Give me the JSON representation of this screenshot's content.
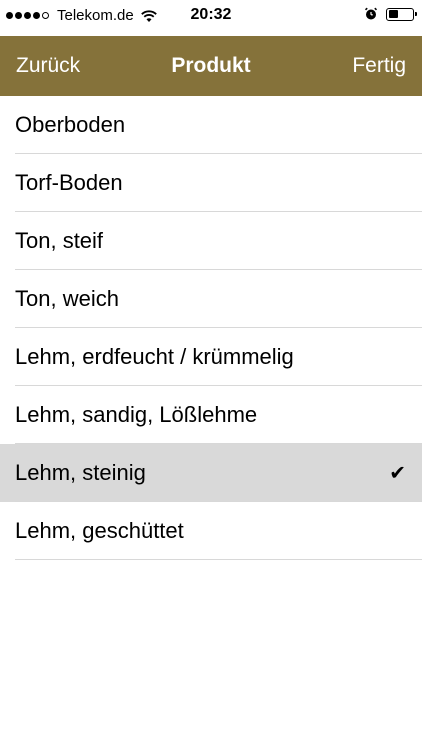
{
  "status_bar": {
    "carrier": "Telekom.de",
    "time": "20:32",
    "signal_bars_filled": 4,
    "signal_bars_total": 5,
    "icons": [
      "wifi-icon",
      "alarm-icon",
      "battery-icon"
    ]
  },
  "nav": {
    "back_label": "Zurück",
    "title": "Produkt",
    "done_label": "Fertig",
    "color": "#85723a"
  },
  "list": {
    "items": [
      {
        "label": "Oberboden",
        "selected": false
      },
      {
        "label": "Torf-Boden",
        "selected": false
      },
      {
        "label": "Ton, steif",
        "selected": false
      },
      {
        "label": "Ton, weich",
        "selected": false
      },
      {
        "label": "Lehm, erdfeucht / krümmelig",
        "selected": false
      },
      {
        "label": "Lehm, sandig, Lößlehme",
        "selected": false
      },
      {
        "label": "Lehm, steinig",
        "selected": true
      },
      {
        "label": "Lehm, geschüttet",
        "selected": false
      }
    ],
    "check_glyph": "✔"
  }
}
